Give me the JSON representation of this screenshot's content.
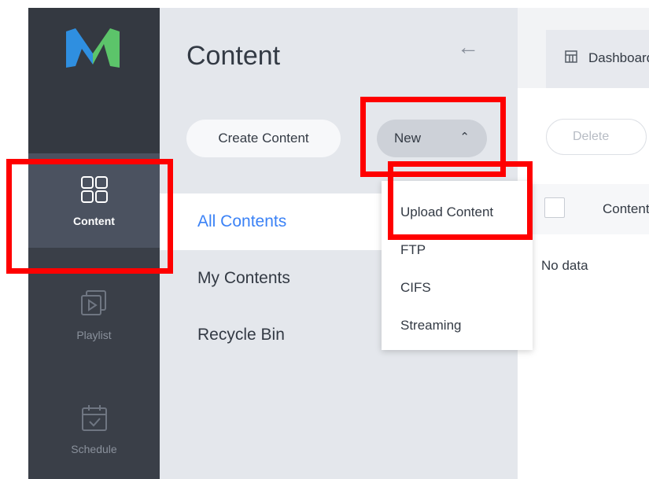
{
  "sidebar": {
    "logo_icon": "logo-m-icon",
    "items": [
      {
        "label": "Content",
        "icon": "grid-icon",
        "active": true
      },
      {
        "label": "Playlist",
        "icon": "playlist-icon",
        "active": false
      },
      {
        "label": "Schedule",
        "icon": "calendar-icon",
        "active": false
      }
    ]
  },
  "panel": {
    "title": "Content",
    "back_icon": "back-arrow-icon",
    "create_label": "Create Content",
    "new_label": "New",
    "new_chevron": "⌃",
    "nav": [
      {
        "label": "All Contents",
        "active": true
      },
      {
        "label": "My Contents",
        "active": false
      },
      {
        "label": "Recycle Bin",
        "active": false
      }
    ]
  },
  "dropdown": {
    "items": [
      "Upload Content",
      "FTP",
      "CIFS",
      "Streaming"
    ]
  },
  "main": {
    "tab_label": "Dashboard",
    "delete_label": "Delete",
    "column_header": "Content",
    "empty_text": "No data"
  },
  "colors": {
    "rail": "#3a3f48",
    "panel": "#e4e7ec",
    "accent": "#3b82f6",
    "highlight": "#ff0000",
    "logo_blue": "#2f8fe0",
    "logo_green": "#5cc46a"
  }
}
